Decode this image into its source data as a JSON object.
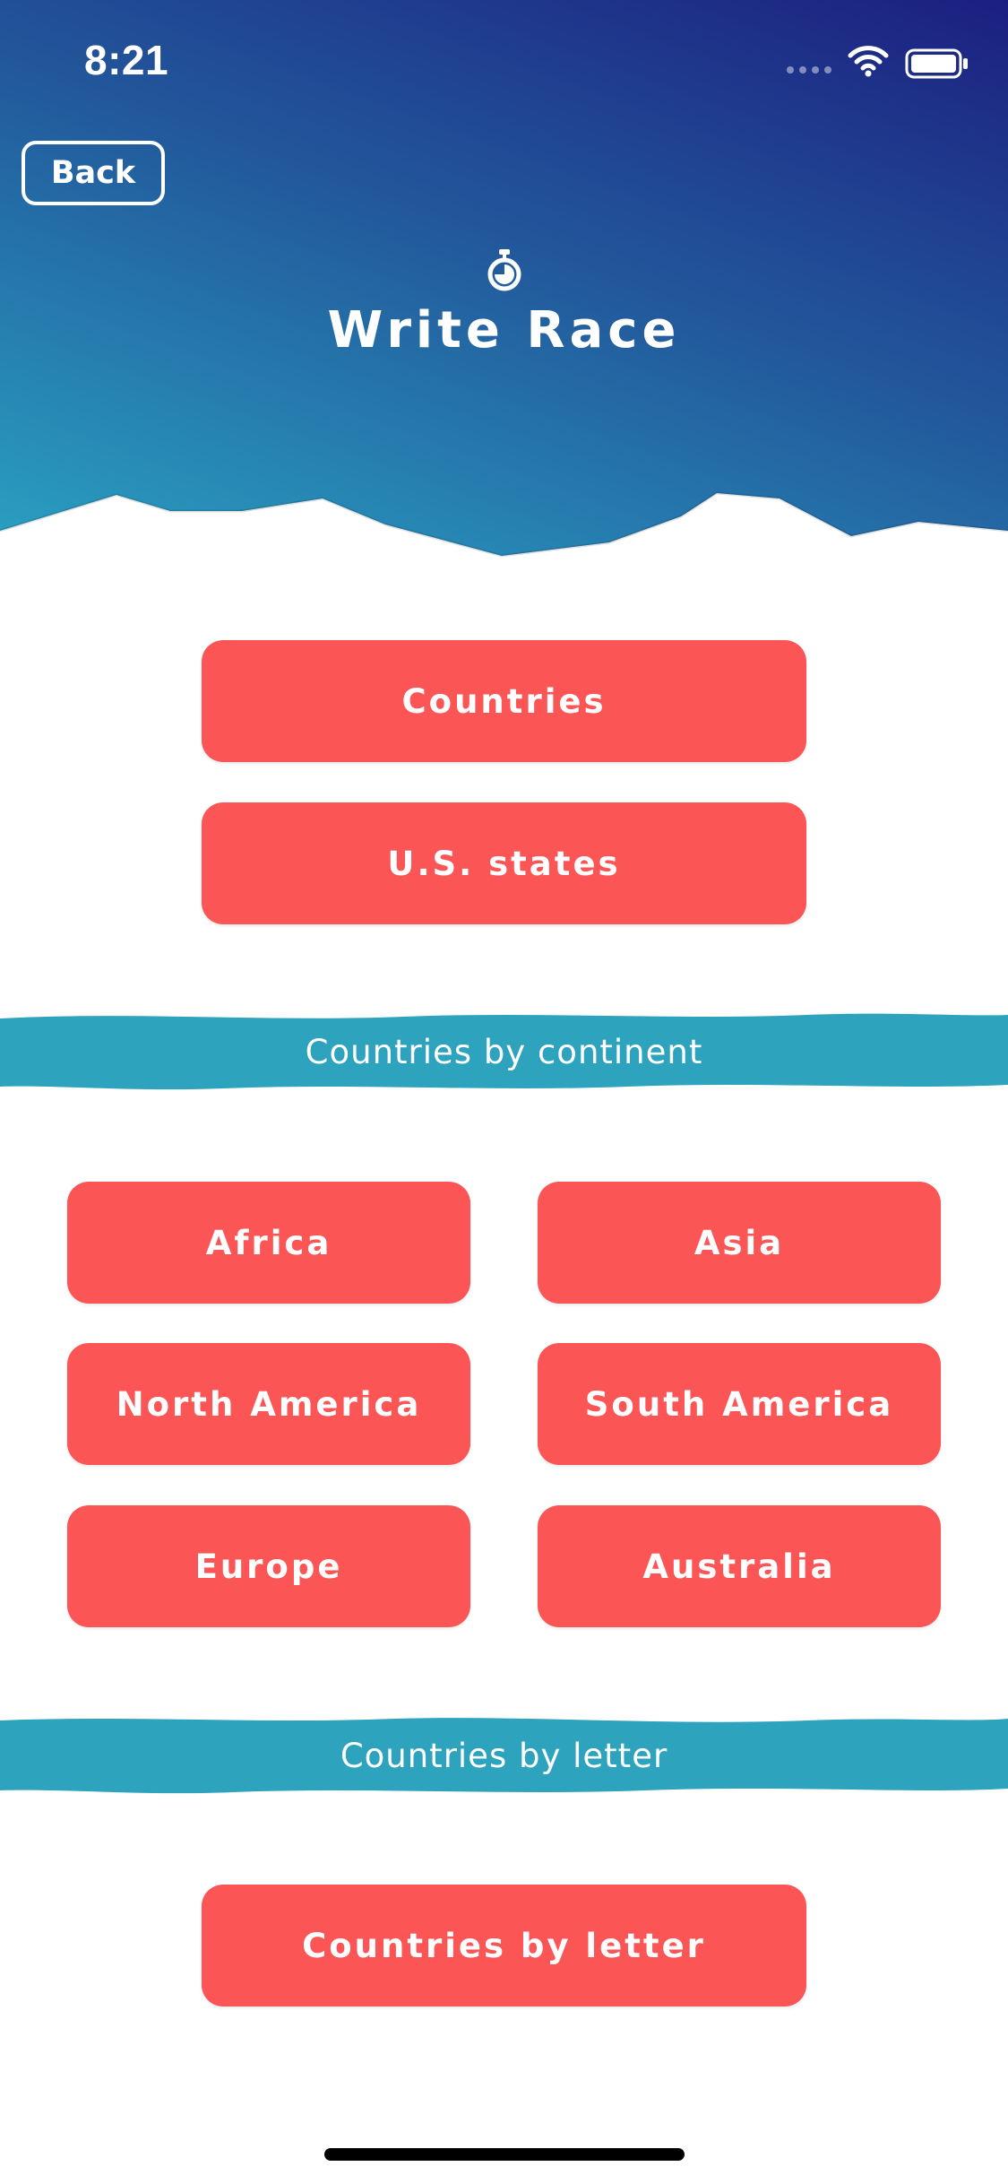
{
  "status_bar": {
    "time": "8:21",
    "icons": [
      "cellular-signal-icon",
      "wifi-icon",
      "battery-icon"
    ]
  },
  "header": {
    "back_label": "Back",
    "title": "Write Race",
    "title_icon": "stopwatch-icon"
  },
  "main_buttons": {
    "countries": "Countries",
    "us_states": "U.S. states"
  },
  "continent_section": {
    "title": "Countries by continent",
    "buttons": [
      "Africa",
      "Asia",
      "North America",
      "South America",
      "Europe",
      "Australia"
    ]
  },
  "letter_section": {
    "title": "Countries by letter",
    "button": "Countries by letter"
  },
  "colors": {
    "button": "#fb5555",
    "banner": "#2ea3be",
    "header_gradient_start": "#1c1f80",
    "header_gradient_end": "#2aa4c3"
  }
}
